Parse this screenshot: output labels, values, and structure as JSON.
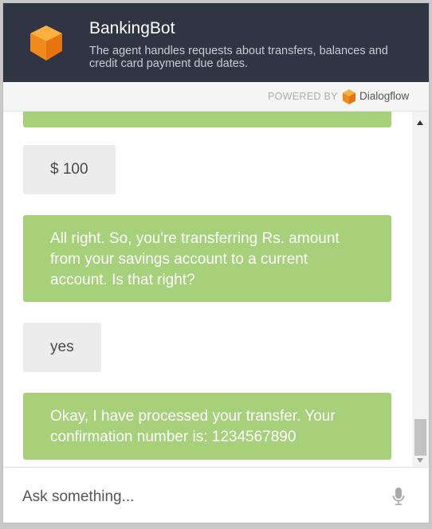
{
  "header": {
    "agent_name": "BankingBot",
    "description": "The agent handles requests about transfers, balances and credit card payment due dates."
  },
  "powered_by": {
    "label": "POWERED BY",
    "brand": "Dialogflow"
  },
  "messages": [
    {
      "from": "bot",
      "text": ""
    },
    {
      "from": "user",
      "text": "$ 100"
    },
    {
      "from": "bot",
      "text": "All right. So, you're transferring Rs. amount from your savings account to a current account. Is that right?"
    },
    {
      "from": "user",
      "text": "yes"
    },
    {
      "from": "bot",
      "text": "Okay, I have processed your transfer. Your confirmation number is: 1234567890"
    }
  ],
  "input": {
    "placeholder": "Ask something..."
  },
  "icons": {
    "logo": "bot-cube-icon",
    "brand": "dialogflow-icon",
    "mic": "microphone-icon",
    "scroll_up": "scroll-up-arrow-icon",
    "scroll_down": "scroll-down-arrow-icon"
  },
  "colors": {
    "header_bg": "#2f3542",
    "bot_bubble": "#a6d07a",
    "user_bubble": "#ececec",
    "logo_orange": "#f39c1f"
  }
}
